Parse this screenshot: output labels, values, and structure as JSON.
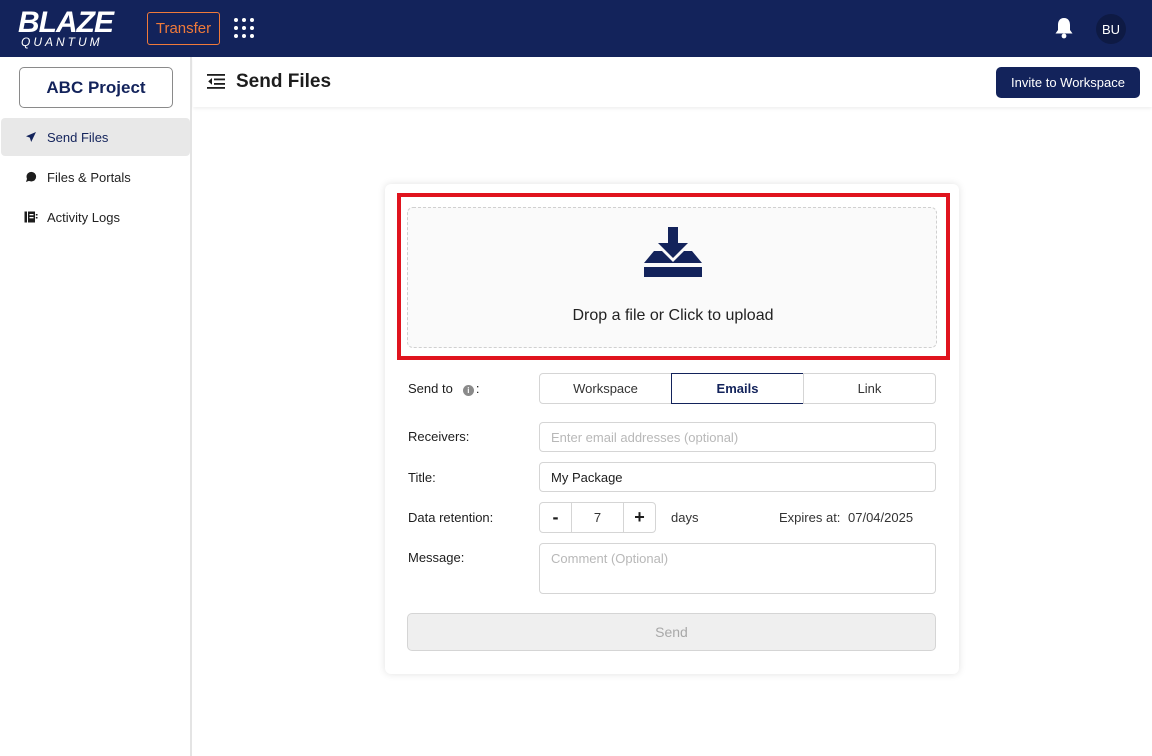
{
  "topbar": {
    "logo_line1": "BLAZE",
    "logo_line2": "QUANTUM",
    "product_label": "Transfer",
    "apps_icon": "grid-dots-icon",
    "bell_icon": "bell-icon",
    "avatar_initials": "BU",
    "brand_color": "#13235b",
    "accent_color": "#f07a3a"
  },
  "sidebar": {
    "project_label": "ABC Project",
    "items": [
      {
        "label": "Send Files",
        "icon": "send-icon",
        "active": true
      },
      {
        "label": "Files & Portals",
        "icon": "chat-bubble-icon",
        "active": false
      },
      {
        "label": "Activity Logs",
        "icon": "log-book-icon",
        "active": false
      }
    ]
  },
  "header": {
    "title": "Send Files",
    "invite_label": "Invite to Workspace"
  },
  "form": {
    "dropzone_text": "Drop a file or Click to upload",
    "send_to_label": "Send to",
    "send_to_suffix": ":",
    "send_to_options": [
      "Workspace",
      "Emails",
      "Link"
    ],
    "send_to_selected": "Emails",
    "receivers_label": "Receivers:",
    "receivers_placeholder": "Enter email addresses (optional)",
    "title_label": "Title:",
    "title_value": "My Package",
    "retention_label": "Data retention:",
    "retention_value": "7",
    "retention_minus": "-",
    "retention_plus": "+",
    "retention_unit": "days",
    "expires_label": "Expires at:",
    "expires_value": "07/04/2025",
    "message_label": "Message:",
    "message_placeholder": "Comment (Optional)",
    "send_label": "Send"
  }
}
